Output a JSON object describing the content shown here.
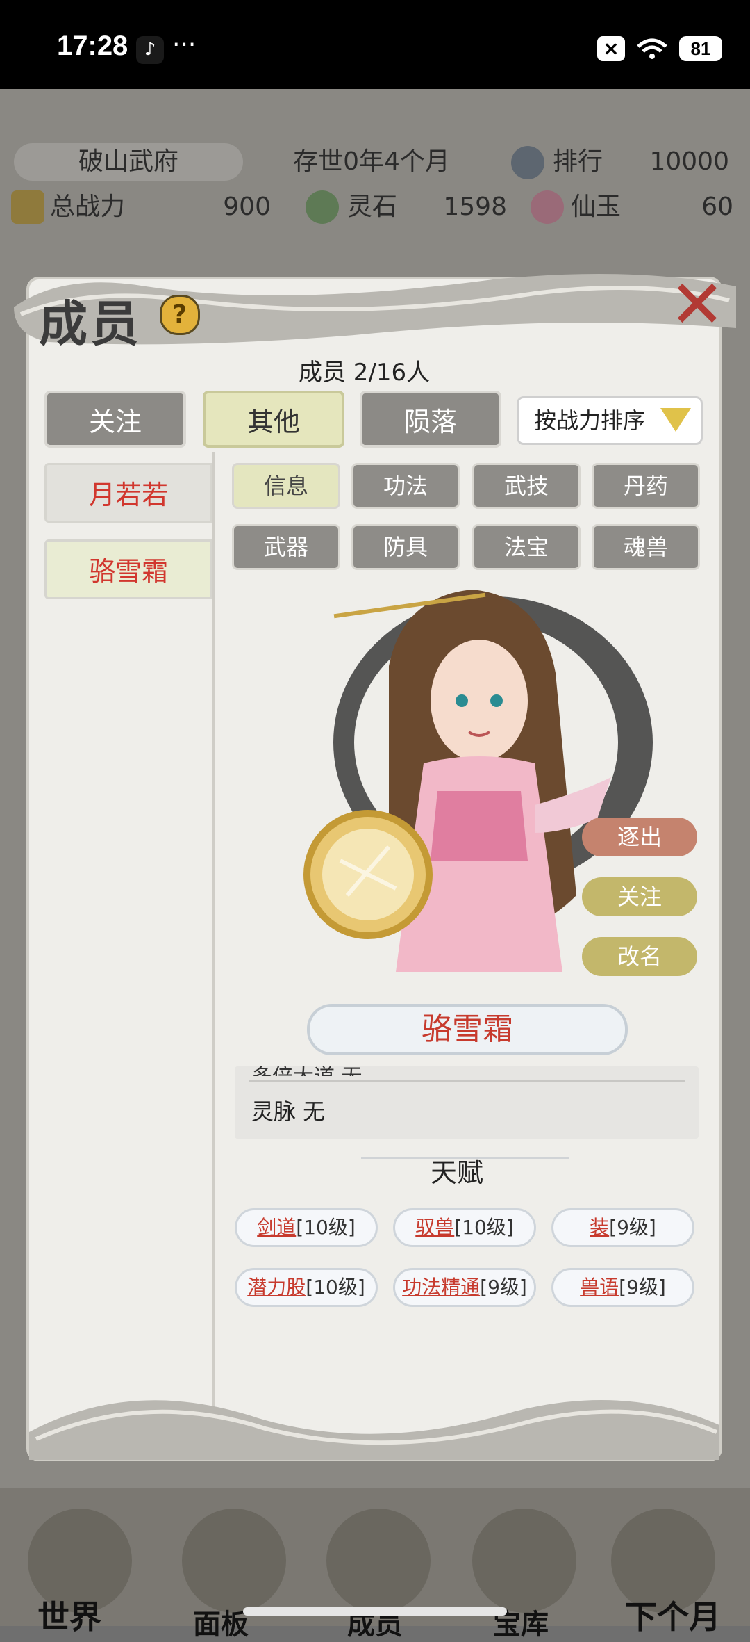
{
  "status_bar": {
    "time": "17:28",
    "more": "···",
    "battery": "81"
  },
  "header": {
    "sect_name": "破山武府",
    "existence": "存世0年4个月",
    "rank_label": "排行",
    "rank_value": "10000",
    "power_label": "总战力",
    "power_value": "900",
    "stone_label": "灵石",
    "stone_value": "1598",
    "jade_label": "仙玉",
    "jade_value": "60"
  },
  "dialog": {
    "title": "成员",
    "help": "?",
    "member_count": "成员  2/16人",
    "filters": [
      "关注",
      "其他",
      "陨落"
    ],
    "active_filter_index": 1,
    "sort_label": "按战力排序",
    "members": [
      "月若若",
      "骆雪霜"
    ],
    "selected_member_index": 1,
    "tabs": [
      "信息",
      "功法",
      "武技",
      "丹药",
      "武器",
      "防具",
      "法宝",
      "魂兽"
    ],
    "active_tab_index": 0,
    "actions": [
      "逐出",
      "关注",
      "改名"
    ],
    "name": "骆雪霜",
    "info_cut_line": "多倍大道 无",
    "info_line": "灵脉 无",
    "talent_title": "天赋",
    "talents": [
      {
        "name": "剑道",
        "level": "[10级]"
      },
      {
        "name": "驭兽",
        "level": "[10级]"
      },
      {
        "name": "装",
        "level": "[9级]"
      },
      {
        "name": "潜力股",
        "level": "[10级]"
      },
      {
        "name": "功法精通",
        "level": "[9级]"
      },
      {
        "name": "兽语",
        "level": "[9级]"
      }
    ]
  },
  "bottom_nav": [
    "世界",
    "面板",
    "成员",
    "宝库",
    "下个月"
  ],
  "colors": {
    "accent_red": "#c73a2d",
    "active_button": "#e4e6bf",
    "inactive_button": "#8e8c88"
  }
}
